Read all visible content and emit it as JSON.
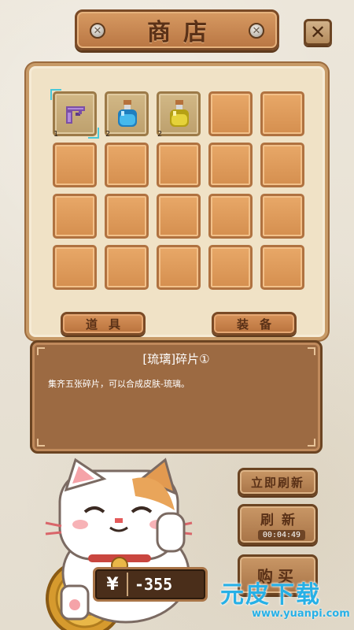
{
  "header": {
    "title": "商店",
    "close_label": "✕"
  },
  "inventory": {
    "slots": [
      {
        "item": "purple-fragment-icon",
        "count": "1",
        "selected": true
      },
      {
        "item": "blue-potion-icon",
        "count": "2"
      },
      {
        "item": "yellow-potion-icon",
        "count": "2"
      }
    ]
  },
  "tabs": {
    "items_label": "道具",
    "equipment_label": "装备"
  },
  "description": {
    "title": "[琉璃]碎片①",
    "text": "集齐五张碎片，可以合成皮肤-琉璃。"
  },
  "actions": {
    "instant_refresh_label": "立即刷新",
    "refresh_label": "刷新",
    "refresh_timer": "00:04:49",
    "buy_label": "购买"
  },
  "currency": {
    "symbol": "¥",
    "value": "-355"
  },
  "watermark": {
    "logo": "元皮下载",
    "url": "www.yuanpi.com"
  },
  "colors": {
    "accent_brown": "#b9723d",
    "slot_orange": "#d58f4f",
    "watermark_blue": "#27b0e6"
  }
}
